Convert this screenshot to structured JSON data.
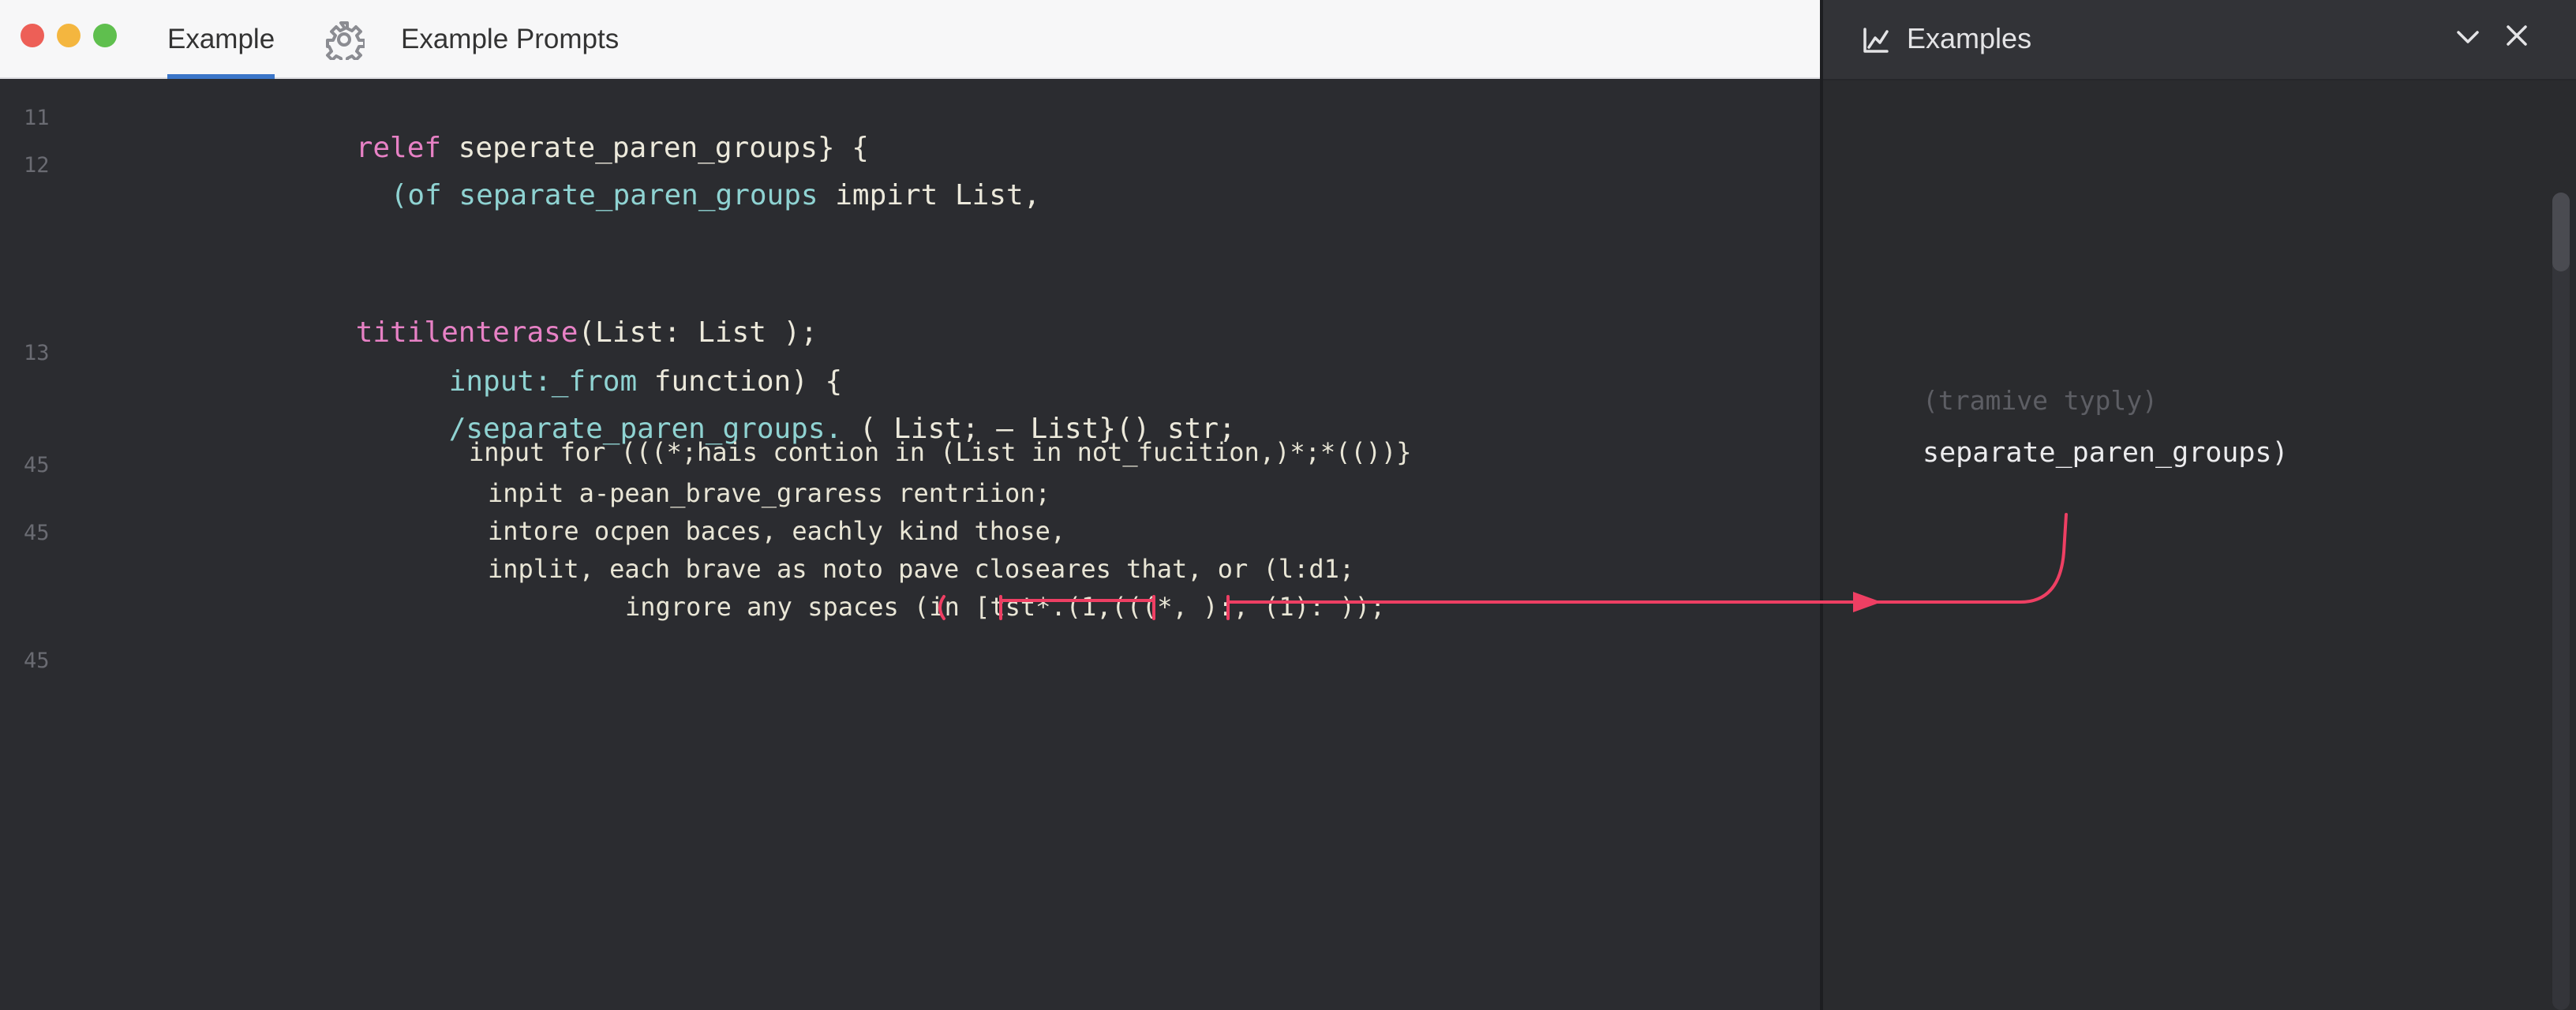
{
  "tabs": {
    "example": "Example",
    "prompts": "Example Prompts"
  },
  "panel": {
    "title": "Examples",
    "hint": "(tramive typly)",
    "result": "separate_paren_groups)"
  },
  "line_numbers": [
    "11",
    "12",
    "13",
    "45",
    "45",
    "45"
  ],
  "code": {
    "l1_kw": "relef",
    "l1_rest": " seperate_paren_groups} {",
    "l2_open": "(of",
    "l2_ident": " separate_paren_groups",
    "l2_rest": " impirt List,",
    "l3_kw": "titilenterase",
    "l3_rest": "(List: List );",
    "l4_a": "input:_from",
    "l4_b": " function) {",
    "l5_a": "/separate_paren_groups.",
    "l5_b": " ( List; — List}() str;",
    "l6": "input for (((*;hais contion in (List in not_fucition,)*;*(())}",
    "l7": "inpit a-pean_brave_graress rentriion;",
    "l8": "intore ocpen baces, eachly kind those,",
    "l9": "inplit, each brave as noto pave closeares that, or (l:d1;",
    "l10": "ingrore any spaces (in [tst*.(1,(((*, ):, (1): ));"
  },
  "colors": {
    "accent_tab": "#3b76c9",
    "arrow": "#ee3f63",
    "keyword_pink": "#e781c5",
    "keyword_cyan": "#8fd3d2"
  }
}
